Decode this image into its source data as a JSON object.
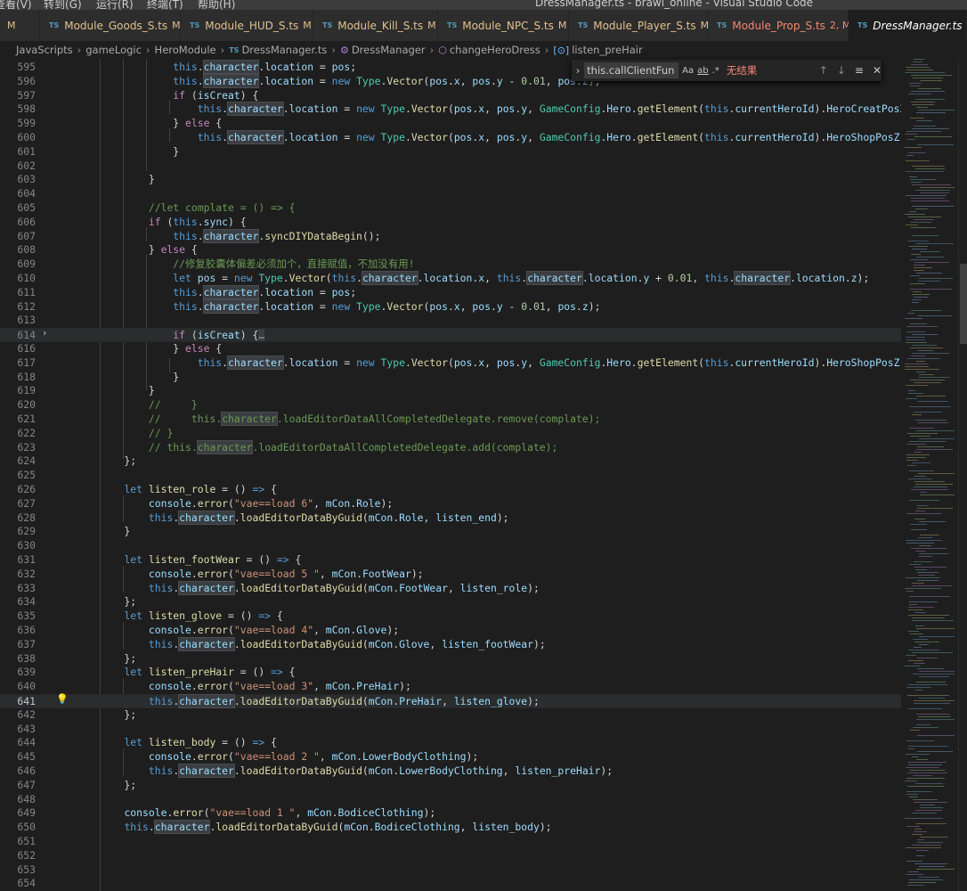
{
  "menu": {
    "items": [
      "查看(V)",
      "转到(G)",
      "运行(R)",
      "终端(T)",
      "帮助(H)"
    ]
  },
  "window": {
    "title": "DressManager.ts - brawl_online - Visual Studio Code"
  },
  "tabs": [
    {
      "name": "",
      "mark": "M",
      "state": "modified"
    },
    {
      "name": "Module_Goods_S.ts",
      "mark": "M",
      "state": "modified"
    },
    {
      "name": "Module_HUD_S.ts",
      "mark": "M",
      "state": "modified"
    },
    {
      "name": "Module_Kill_S.ts",
      "mark": "M",
      "state": "modified"
    },
    {
      "name": "Module_NPC_S.ts",
      "mark": "M",
      "state": "modified"
    },
    {
      "name": "Module_Player_S.ts",
      "mark": "M",
      "state": "modified"
    },
    {
      "name": "Module_Prop_S.ts",
      "mark": "2, M",
      "state": "error"
    },
    {
      "name": "DressManager.ts",
      "mark": "",
      "state": "active"
    }
  ],
  "tab_icon_label": "TS",
  "breadcrumb": {
    "items": [
      "JavaScripts",
      "gameLogic",
      "HeroModule",
      "DressManager.ts",
      "DressManager",
      "changeHeroDress",
      "listen_preHair"
    ]
  },
  "find_widget": {
    "value": "this.callClientFun",
    "case_label": "Aa",
    "word_label": "ab",
    "regex_label": ".*",
    "no_result": "无结果"
  },
  "editor": {
    "current_line": 641,
    "folded_line": 614,
    "lightbulb_line": 641,
    "accent_color": "#1e1e1e"
  }
}
